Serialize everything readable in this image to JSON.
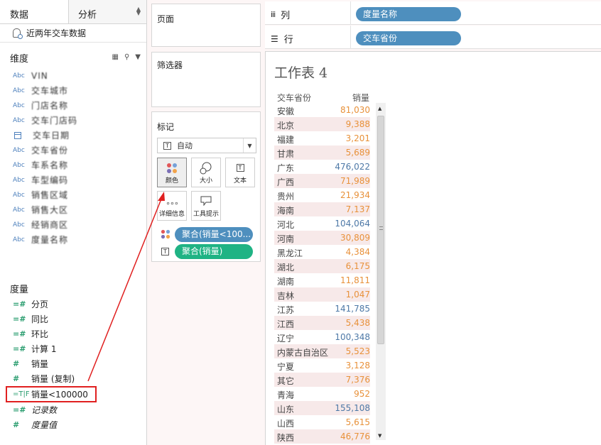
{
  "data_pane": {
    "tab_data": "数据",
    "tab_analysis": "分析",
    "datasource": "近两年交车数据",
    "dimensions_title": "维度",
    "dimensions": [
      {
        "type": "Abc",
        "label": "VIN"
      },
      {
        "type": "Abc",
        "label": "交车城市"
      },
      {
        "type": "Abc",
        "label": "门店名称"
      },
      {
        "type": "Abc",
        "label": "交车门店码"
      },
      {
        "type": "date",
        "label": "交车日期"
      },
      {
        "type": "Abc",
        "label": "交车省份"
      },
      {
        "type": "Abc",
        "label": "车系名称"
      },
      {
        "type": "Abc",
        "label": "车型编码"
      },
      {
        "type": "Abc",
        "label": "销售区域"
      },
      {
        "type": "Abc",
        "label": "销售大区"
      },
      {
        "type": "Abc",
        "label": "经销商区"
      },
      {
        "type": "Abc",
        "label": "度量名称"
      }
    ],
    "measures_title": "度量",
    "measures": [
      {
        "icon": "=#",
        "label": "分页"
      },
      {
        "icon": "=#",
        "label": "同比"
      },
      {
        "icon": "=#",
        "label": "环比"
      },
      {
        "icon": "=#",
        "label": "计算 1"
      },
      {
        "icon": "#",
        "label": "销量"
      },
      {
        "icon": "#",
        "label": "销量 (复制)"
      },
      {
        "icon": "=T|F",
        "label": "销量<100000"
      },
      {
        "icon": "=#",
        "label": "记录数"
      },
      {
        "icon": "#",
        "label": "度量值"
      }
    ]
  },
  "shelves": {
    "pages": "页面",
    "filters": "筛选器",
    "marks": "标记",
    "mark_type": "自动",
    "mark_buttons": [
      "颜色",
      "大小",
      "文本",
      "详细信息",
      "工具提示"
    ],
    "mark_pills": [
      {
        "label": "聚合(销量<100...",
        "color": "#4e8fbe"
      },
      {
        "label": "聚合(销量)",
        "color": "#1fb384"
      }
    ]
  },
  "columns": {
    "label": "列",
    "pill": "度量名称"
  },
  "rows": {
    "label": "行",
    "pill": "交车省份"
  },
  "sheet": {
    "title": "工作表 4",
    "col_province": "交车省份",
    "col_sales": "销量",
    "rows": [
      {
        "province": "安徽",
        "value": "81,030",
        "blue": false
      },
      {
        "province": "北京",
        "value": "9,388",
        "blue": false
      },
      {
        "province": "福建",
        "value": "3,201",
        "blue": false
      },
      {
        "province": "甘肃",
        "value": "5,689",
        "blue": false
      },
      {
        "province": "广东",
        "value": "476,022",
        "blue": true
      },
      {
        "province": "广西",
        "value": "71,989",
        "blue": false
      },
      {
        "province": "贵州",
        "value": "21,934",
        "blue": false
      },
      {
        "province": "海南",
        "value": "7,137",
        "blue": false
      },
      {
        "province": "河北",
        "value": "104,064",
        "blue": true
      },
      {
        "province": "河南",
        "value": "30,809",
        "blue": false
      },
      {
        "province": "黑龙江",
        "value": "4,384",
        "blue": false
      },
      {
        "province": "湖北",
        "value": "6,175",
        "blue": false
      },
      {
        "province": "湖南",
        "value": "11,811",
        "blue": false
      },
      {
        "province": "吉林",
        "value": "1,047",
        "blue": false
      },
      {
        "province": "江苏",
        "value": "141,785",
        "blue": true
      },
      {
        "province": "江西",
        "value": "5,438",
        "blue": false
      },
      {
        "province": "辽宁",
        "value": "100,348",
        "blue": true
      },
      {
        "province": "内蒙古自治区",
        "value": "5,523",
        "blue": false
      },
      {
        "province": "宁夏",
        "value": "3,128",
        "blue": false
      },
      {
        "province": "其它",
        "value": "7,376",
        "blue": false
      },
      {
        "province": "青海",
        "value": "952",
        "blue": false
      },
      {
        "province": "山东",
        "value": "155,108",
        "blue": true
      },
      {
        "province": "山西",
        "value": "5,615",
        "blue": false
      },
      {
        "province": "陕西",
        "value": "46,776",
        "blue": false
      }
    ]
  }
}
